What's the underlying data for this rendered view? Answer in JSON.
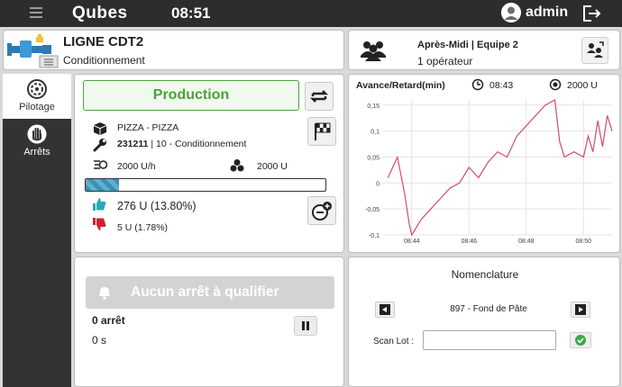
{
  "header": {
    "brand": "Qubes",
    "time": "08:51",
    "user": "admin"
  },
  "line": {
    "title": "LIGNE CDT2",
    "subtitle": "Conditionnement"
  },
  "team": {
    "shift": "Après-Midi | Equipe 2",
    "operators": "1 opérateur"
  },
  "sidebar": {
    "items": [
      {
        "label": "Pilotage",
        "icon": "gauge-icon",
        "active": true
      },
      {
        "label": "Arrêts",
        "icon": "hand-stop-icon",
        "active": false
      }
    ]
  },
  "production": {
    "state_label": "Production",
    "product": "PIZZA - PIZZA",
    "order_number": "231211",
    "order_detail": " | 10 - Conditionnement",
    "rate": "2000 U/h",
    "quantity": "2000 U",
    "progress_percent": 13.8,
    "good": "276 U (13.80%)",
    "rejects": "5 U (1.78%)",
    "color_good": "#2aa9b5",
    "color_bad": "#d0202e"
  },
  "chart": {
    "title": "Avance/Retard(min)",
    "time": "08:43",
    "qty": "2000 U"
  },
  "chart_data": {
    "type": "line",
    "x": [
      "08:43:10",
      "08:43:30",
      "08:43:45",
      "08:43:55",
      "08:44:00",
      "08:44:20",
      "08:44:40",
      "08:45:00",
      "08:45:20",
      "08:45:40",
      "08:46:00",
      "08:46:20",
      "08:46:40",
      "08:47:00",
      "08:47:20",
      "08:47:40",
      "08:48:00",
      "08:48:20",
      "08:48:40",
      "08:49:00",
      "08:49:10",
      "08:49:20",
      "08:49:40",
      "08:50:00",
      "08:50:10",
      "08:50:20",
      "08:50:30",
      "08:50:40",
      "08:50:50",
      "08:51:00"
    ],
    "values": [
      0.01,
      0.05,
      -0.02,
      -0.08,
      -0.1,
      -0.07,
      -0.05,
      -0.03,
      -0.01,
      0.0,
      0.03,
      0.01,
      0.04,
      0.06,
      0.05,
      0.09,
      0.11,
      0.13,
      0.15,
      0.16,
      0.08,
      0.05,
      0.06,
      0.05,
      0.09,
      0.06,
      0.12,
      0.07,
      0.13,
      0.1
    ],
    "xticks": [
      "08:44",
      "08:46",
      "08:48",
      "08:50"
    ],
    "yticks": [
      "0,15",
      "0,1",
      "0,05",
      "0",
      "-0,05",
      "-0,1"
    ],
    "ylim": [
      -0.1,
      0.16
    ],
    "grid": true,
    "color": "#d04a78"
  },
  "stops": {
    "banner": "Aucun arrêt à qualifier",
    "count": "0 arrêt",
    "duration": "0 s"
  },
  "nomenclature": {
    "title": "Nomenclature",
    "item": "897 - Fond de Pâte",
    "scan_label": "Scan Lot :",
    "scan_value": ""
  }
}
